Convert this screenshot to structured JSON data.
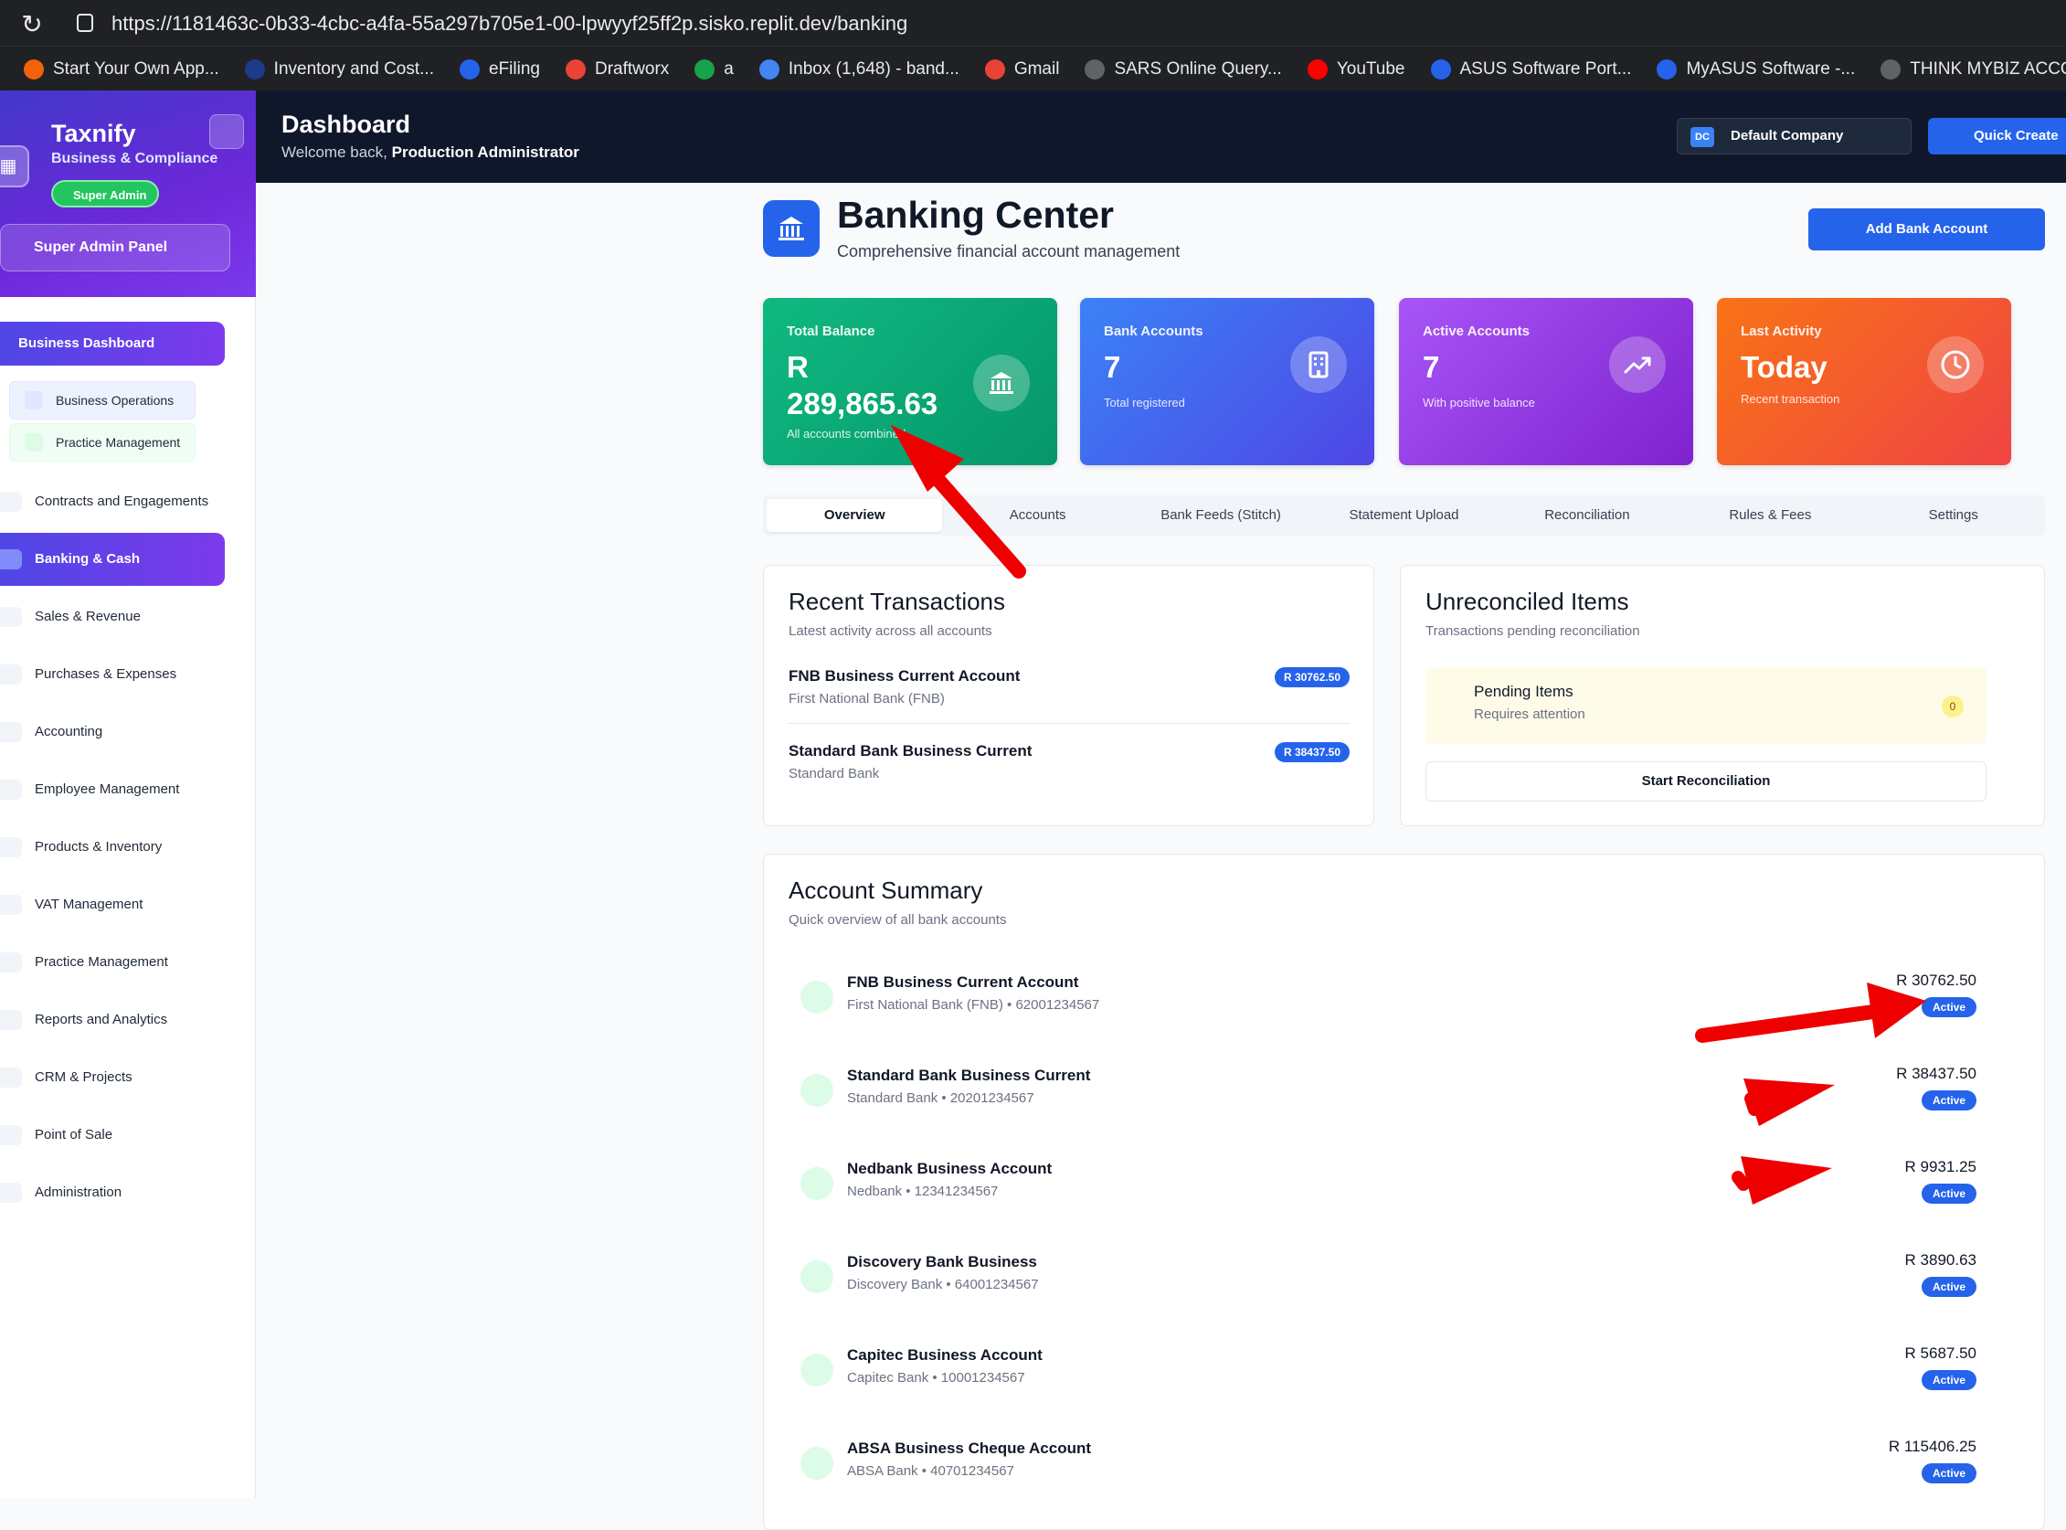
{
  "browser": {
    "url": "https://1181463c-0b33-4cbc-a4fa-55a297b705e1-00-lpwyyf25ff2p.sisko.replit.dev/banking",
    "bookmarks": [
      {
        "label": "Start Your Own App...",
        "icon": "replit-icon",
        "color": "#f26207"
      },
      {
        "label": "Inventory and Cost...",
        "icon": "ac-icon",
        "color": "#1e3a8a"
      },
      {
        "label": "eFiling",
        "icon": "efiling-icon",
        "color": "#2563eb"
      },
      {
        "label": "Draftworx",
        "icon": "draftworx-icon",
        "color": "#ea4335"
      },
      {
        "label": "a",
        "icon": "globe-icon",
        "color": "#16a34a"
      },
      {
        "label": "Inbox (1,648) - band...",
        "icon": "google-icon",
        "color": "#4285f4"
      },
      {
        "label": "Gmail",
        "icon": "gmail-icon",
        "color": "#ea4335"
      },
      {
        "label": "SARS Online Query...",
        "icon": "globe-icon",
        "color": "#5f6368"
      },
      {
        "label": "YouTube",
        "icon": "youtube-icon",
        "color": "#ff0000"
      },
      {
        "label": "ASUS Software Port...",
        "icon": "asus-icon",
        "color": "#2563eb"
      },
      {
        "label": "MyASUS Software -...",
        "icon": "asus-icon",
        "color": "#2563eb"
      },
      {
        "label": "THINK MYBIZ ACCO...",
        "icon": "gear-icon",
        "color": "#5f6368"
      }
    ]
  },
  "sidebar": {
    "app_name": "Taxnify",
    "app_sub": "Business & Compliance",
    "role_badge": "Super Admin",
    "panel_button": "Super Admin Panel",
    "main_item": "Business Dashboard",
    "sub_items": [
      {
        "label": "Business Operations",
        "color": "#e0e7ff"
      },
      {
        "label": "Practice Management",
        "color": "#dcfce7"
      }
    ],
    "items": [
      "Contracts and Engagements",
      "Banking & Cash",
      "Sales & Revenue",
      "Purchases & Expenses",
      "Accounting",
      "Employee Management",
      "Products & Inventory",
      "VAT Management",
      "Practice Management",
      "Reports and Analytics",
      "CRM & Projects",
      "Point of Sale",
      "Administration"
    ],
    "active_item": "Banking & Cash"
  },
  "topbar": {
    "title": "Dashboard",
    "welcome_prefix": "Welcome back, ",
    "user": "Production Administrator",
    "company_initials": "DC",
    "company": "Default Company",
    "quick_create": "Quick Create"
  },
  "page": {
    "title": "Banking Center",
    "subtitle": "Comprehensive financial account management",
    "add_button": "Add Bank Account"
  },
  "cards": [
    {
      "label": "Total Balance",
      "value": "R 289,865.63",
      "sub": "All accounts combined",
      "icon": "bank-icon"
    },
    {
      "label": "Bank Accounts",
      "value": "7",
      "sub": "Total registered",
      "icon": "building-icon"
    },
    {
      "label": "Active Accounts",
      "value": "7",
      "sub": "With positive balance",
      "icon": "trending-up-icon"
    },
    {
      "label": "Last Activity",
      "value": "Today",
      "sub": "Recent transaction",
      "icon": "clock-icon"
    }
  ],
  "tabs": [
    "Overview",
    "Accounts",
    "Bank Feeds (Stitch)",
    "Statement Upload",
    "Reconciliation",
    "Rules & Fees",
    "Settings"
  ],
  "active_tab": "Overview",
  "recent_transactions": {
    "title": "Recent Transactions",
    "subtitle": "Latest activity across all accounts",
    "items": [
      {
        "name": "FNB Business Current Account",
        "bank": "First National Bank (FNB)",
        "amount": "R 30762.50"
      },
      {
        "name": "Standard Bank Business Current",
        "bank": "Standard Bank",
        "amount": "R 38437.50"
      }
    ]
  },
  "unreconciled": {
    "title": "Unreconciled Items",
    "subtitle": "Transactions pending reconciliation",
    "pending_title": "Pending Items",
    "pending_sub": "Requires attention",
    "pending_count": "0",
    "button": "Start Reconciliation"
  },
  "account_summary": {
    "title": "Account Summary",
    "subtitle": "Quick overview of all bank accounts",
    "accounts": [
      {
        "name": "FNB Business Current Account",
        "detail": "First National Bank (FNB) • 62001234567",
        "balance": "R 30762.50",
        "status": "Active"
      },
      {
        "name": "Standard Bank Business Current",
        "detail": "Standard Bank • 20201234567",
        "balance": "R 38437.50",
        "status": "Active"
      },
      {
        "name": "Nedbank Business Account",
        "detail": "Nedbank • 12341234567",
        "balance": "R 9931.25",
        "status": "Active"
      },
      {
        "name": "Discovery Bank Business",
        "detail": "Discovery Bank • 64001234567",
        "balance": "R 3890.63",
        "status": "Active"
      },
      {
        "name": "Capitec Business Account",
        "detail": "Capitec Bank • 10001234567",
        "balance": "R 5687.50",
        "status": "Active"
      },
      {
        "name": "ABSA Business Cheque Account",
        "detail": "ABSA Bank • 40701234567",
        "balance": "R 115406.25",
        "status": "Active"
      }
    ]
  },
  "annotation_color": "#ef0000"
}
